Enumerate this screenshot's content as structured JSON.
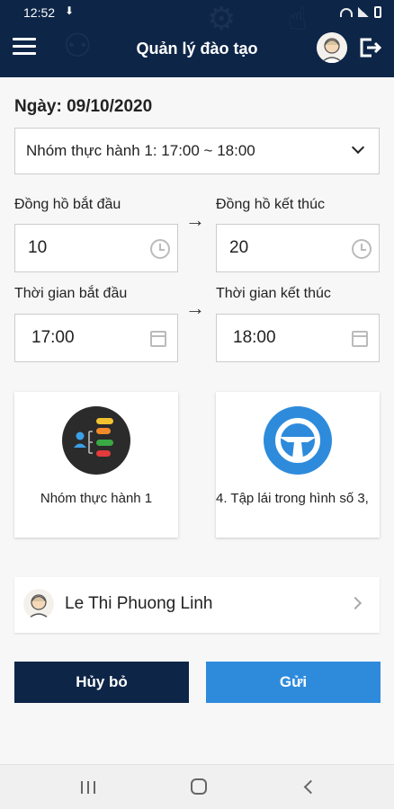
{
  "status_bar": {
    "time": "12:52"
  },
  "header": {
    "title": "Quản lý đào tạo"
  },
  "date_label": "Ngày: 09/10/2020",
  "group_select": {
    "value": "Nhóm thực hành 1: 17:00 ~ 18:00"
  },
  "clock_start": {
    "label": "Đồng hồ bắt đầu",
    "value": "10"
  },
  "clock_end": {
    "label": "Đồng hồ kết thúc",
    "value": "20"
  },
  "time_start": {
    "label": "Thời gian bắt đầu",
    "value": "17:00"
  },
  "time_end": {
    "label": "Thời gian kết thúc",
    "value": "18:00"
  },
  "arrow": "→",
  "cards": [
    {
      "caption": "Nhóm thực hành 1"
    },
    {
      "caption": "4. Tập lái trong hình số 3,"
    }
  ],
  "person": {
    "name": "Le Thi Phuong Linh"
  },
  "buttons": {
    "cancel": "Hủy bỏ",
    "send": "Gửi"
  },
  "colors": {
    "header": "#0d2547",
    "send": "#2e8bdc",
    "cancel": "#0d2547",
    "card_blue": "#2e8bdc",
    "card_dark": "#2b2b2b"
  }
}
